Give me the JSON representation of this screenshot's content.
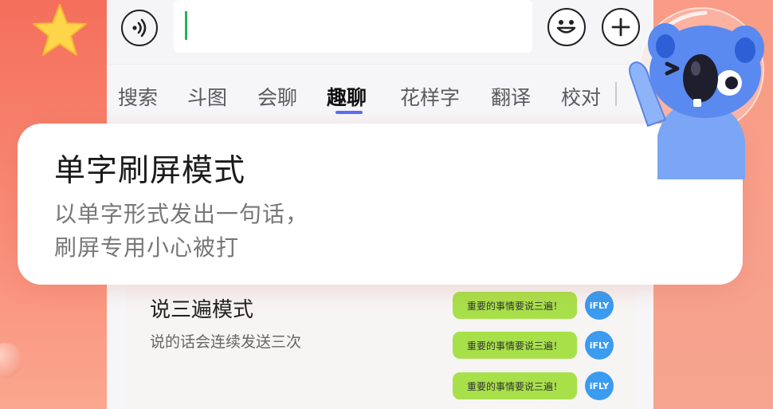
{
  "tabs": [
    {
      "label": "搜索",
      "active": false
    },
    {
      "label": "斗图",
      "active": false
    },
    {
      "label": "会聊",
      "active": false
    },
    {
      "label": "趣聊",
      "active": true
    },
    {
      "label": "花样字",
      "active": false
    },
    {
      "label": "翻译",
      "active": false
    },
    {
      "label": "校对",
      "active": false
    }
  ],
  "input": {
    "value": ""
  },
  "icons": {
    "voice": "voice-icon",
    "emoji": "smiley-icon",
    "plus": "plus-icon"
  },
  "card": {
    "title": "单字刷屏模式",
    "line1": "以单字形式发出一句话，",
    "line2": "刷屏专用小心被打"
  },
  "repeat_mode": {
    "title": "说三遍模式",
    "desc": "说的话会连续发送三次",
    "bubbles": [
      "重要的事情要说三遍！",
      "重要的事情要说三遍！",
      "重要的事情要说三遍！"
    ],
    "avatar_label": "iFLY"
  },
  "colors": {
    "accent": "#5b6bf5",
    "bubble": "#a8e04a",
    "avatar": "#3a9bf0",
    "background": "#f57f6a"
  }
}
